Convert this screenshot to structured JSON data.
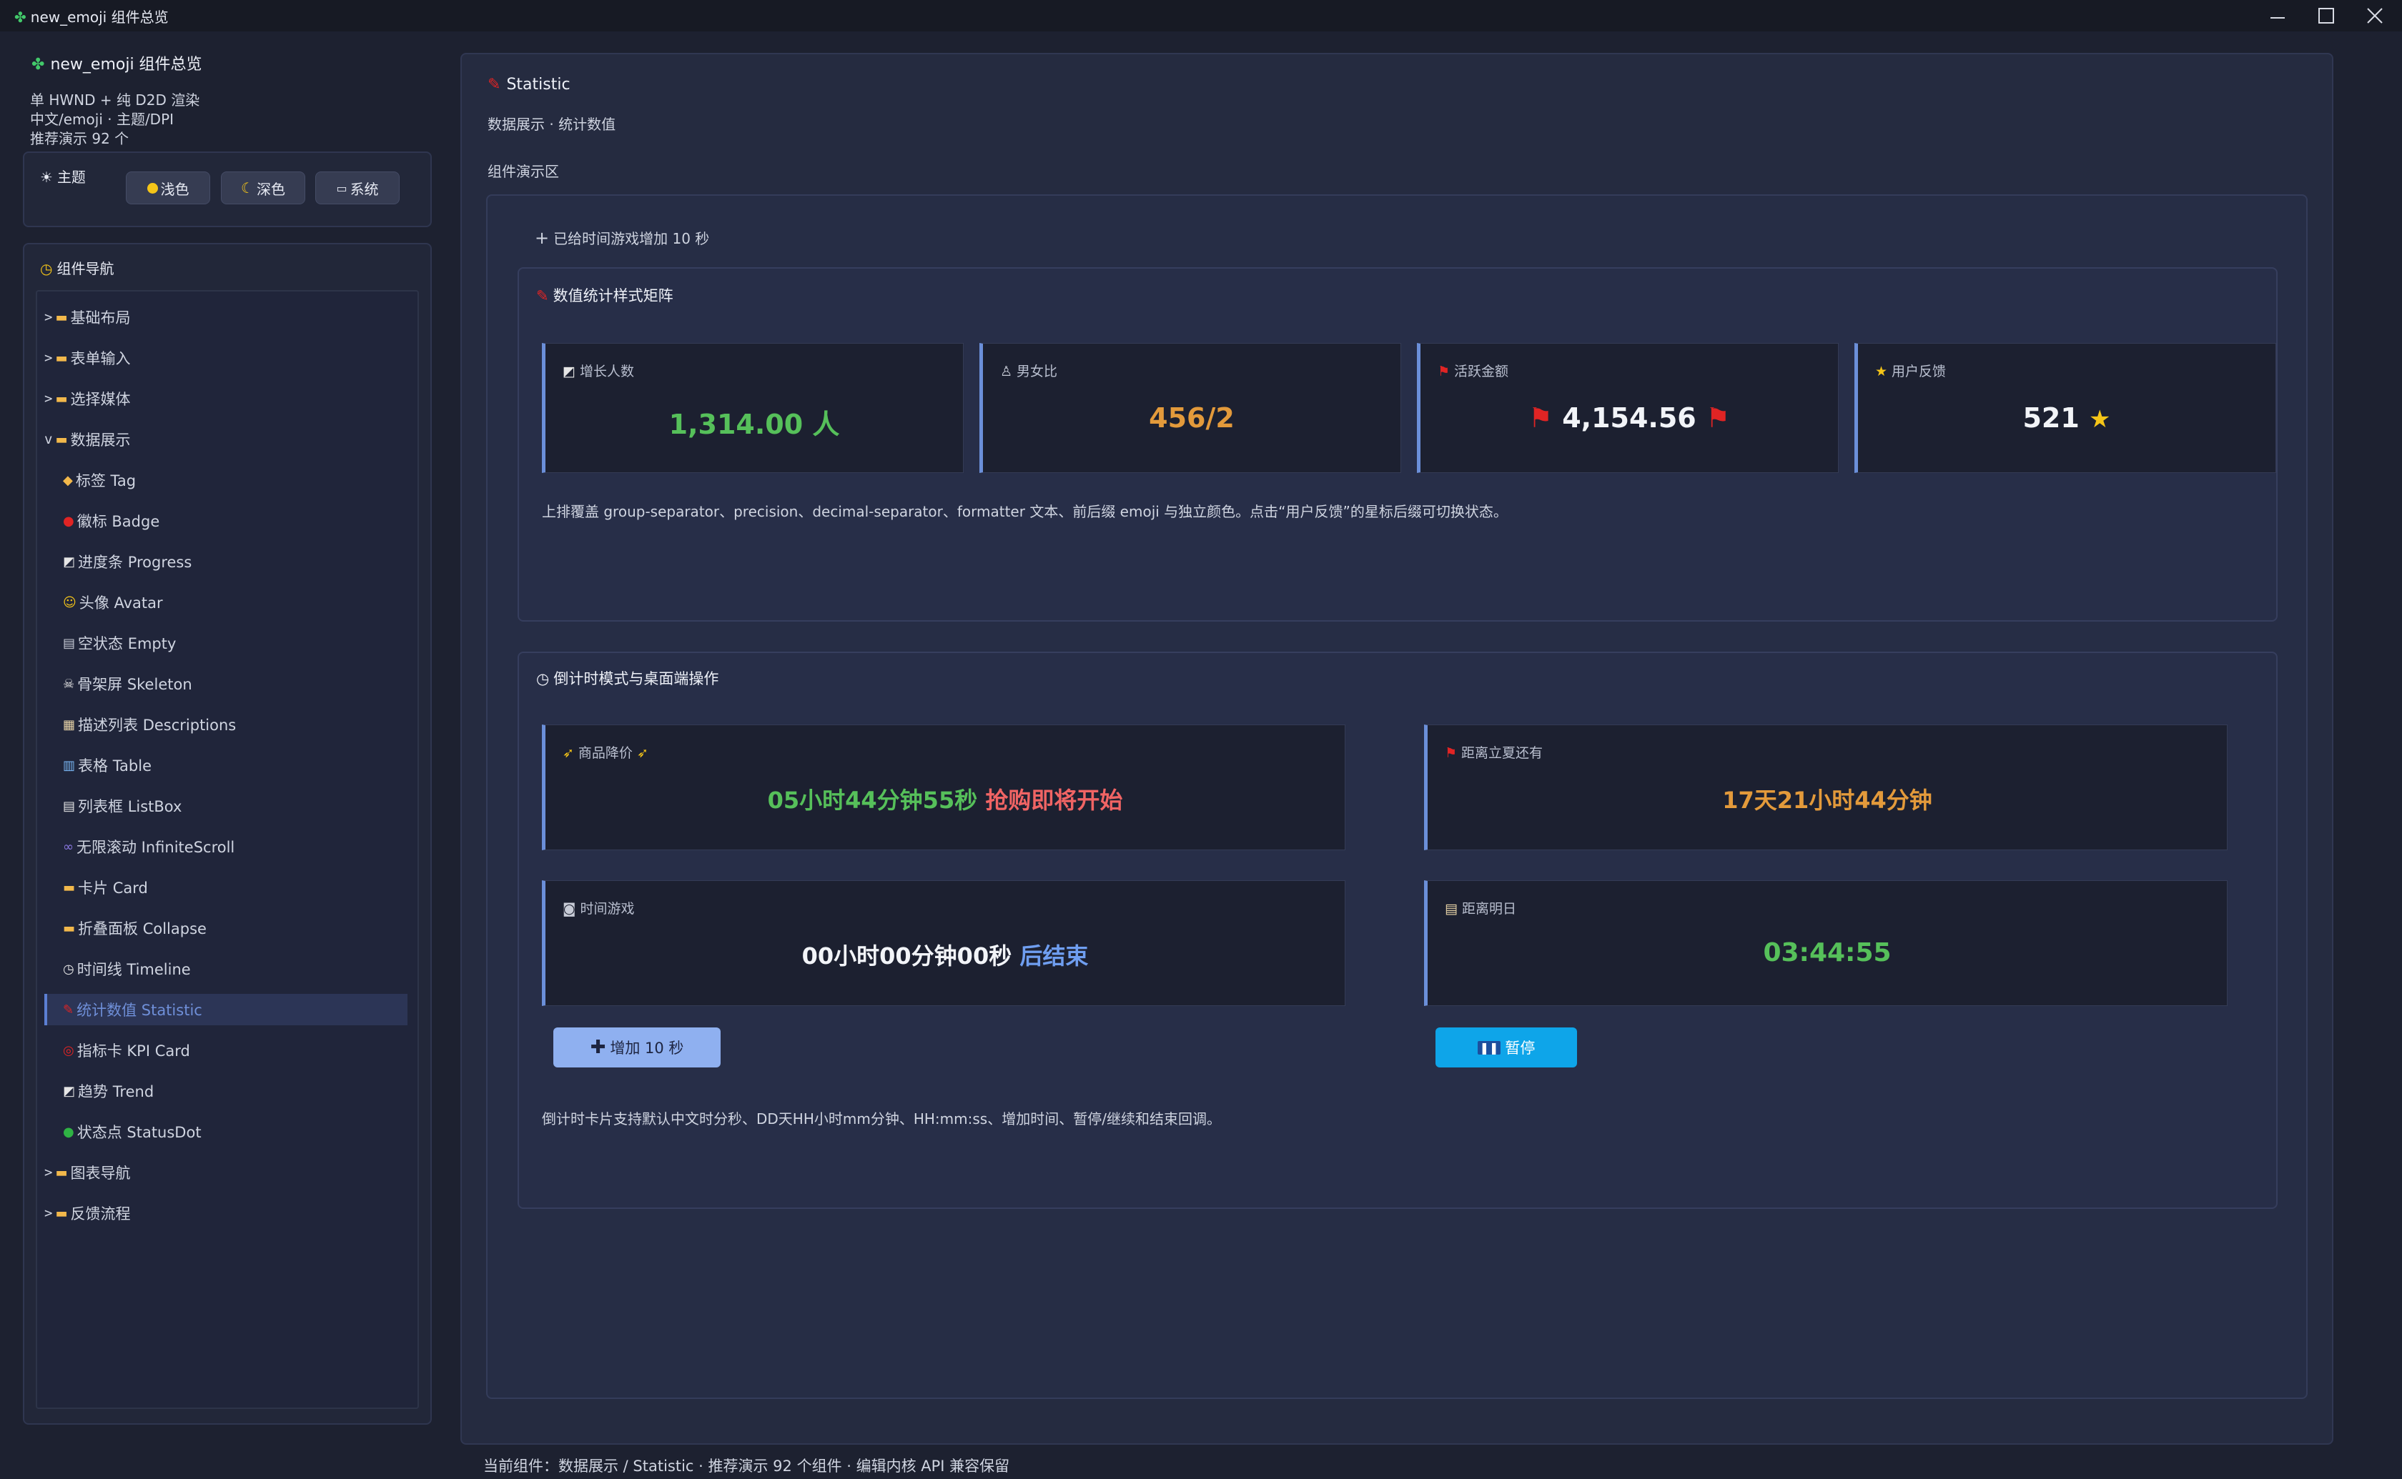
{
  "window": {
    "title": "new_emoji 组件总览",
    "app_icon": "puzzle-icon"
  },
  "sidebar": {
    "title": "new_emoji 组件总览",
    "info": [
      "单 HWND + 纯 D2D 渲染",
      "中文/emoji · 主题/DPI",
      "推荐演示 92 个"
    ],
    "theme": {
      "title": "主题",
      "buttons": [
        {
          "icon": "sun-icon",
          "label": "浅色"
        },
        {
          "icon": "moon-icon",
          "label": "深色"
        },
        {
          "icon": "laptop-icon",
          "label": "系统"
        }
      ]
    },
    "nav_title": "组件导航",
    "nav": [
      {
        "prefix": ">",
        "label": "基础布局"
      },
      {
        "prefix": ">",
        "label": "表单输入"
      },
      {
        "prefix": ">",
        "label": "选择媒体"
      },
      {
        "prefix": "v",
        "label": "数据展示"
      },
      {
        "label": "标签 Tag"
      },
      {
        "label": "徽标 Badge"
      },
      {
        "label": "进度条 Progress"
      },
      {
        "label": "头像 Avatar"
      },
      {
        "label": "空状态 Empty"
      },
      {
        "label": "骨架屏 Skeleton"
      },
      {
        "label": "描述列表 Descriptions"
      },
      {
        "label": "表格 Table"
      },
      {
        "label": "列表框 ListBox"
      },
      {
        "label": "无限滚动 InfiniteScroll"
      },
      {
        "label": "卡片 Card"
      },
      {
        "label": "折叠面板 Collapse"
      },
      {
        "label": "时间线 Timeline"
      },
      {
        "label": "统计数值 Statistic"
      },
      {
        "label": "指标卡 KPI Card"
      },
      {
        "label": "趋势 Trend"
      },
      {
        "label": "状态点 StatusDot"
      },
      {
        "prefix": ">",
        "label": "图表导航"
      },
      {
        "prefix": ">",
        "label": "反馈流程"
      }
    ]
  },
  "main": {
    "title": "Statistic",
    "subtitle": "数据展示 · 统计数值",
    "demo_title": "组件演示区",
    "notice": "已给时间游戏增加 10 秒",
    "matrix": {
      "title": "数值统计样式矩阵",
      "cards": [
        {
          "icon": "chart-up-icon",
          "label": "增长人数",
          "value": "1,314.00 人",
          "color": "#56c05a"
        },
        {
          "icon": "person-icon",
          "label": "男女比",
          "value": "456/2",
          "color": "#e39a3b"
        },
        {
          "icon": "flag-icon",
          "label": "活跃金额",
          "value": "4,154.56",
          "color": "#f2f4f8"
        },
        {
          "icon": "star-icon",
          "label": "用户反馈",
          "value": "521",
          "color": "#f2f4f8"
        }
      ],
      "desc": "上排覆盖 group-separator、precision、decimal-separator、formatter 文本、前后缀 emoji 与独立颜色。点击“用户反馈”的星标后缀可切换状态。"
    },
    "countdown": {
      "title": "倒计时模式与桌面端操作",
      "cards": [
        {
          "label": "商品降价",
          "value": "05小时44分钟55秒",
          "suffix": "抢购即将开始",
          "color": "#56c05a",
          "suffix_color": "#f06464"
        },
        {
          "label": "距离立夏还有",
          "value": "17天21小时44分钟",
          "color": "#e39a3b"
        },
        {
          "label": "时间游戏",
          "value": "00小时00分钟00秒",
          "suffix": "后结束",
          "color": "#f2f4f8",
          "suffix_color": "#6f9ef0"
        },
        {
          "label": "距离明日",
          "value": "03:44:55",
          "color": "#56c05a"
        }
      ],
      "add_button": "增加 10 秒",
      "pause_button": "暂停",
      "desc": "倒计时卡片支持默认中文时分秒、DD天HH小时mm分钟、HH:mm:ss、增加时间、暂停/继续和结束回调。"
    }
  },
  "status": "当前组件：数据展示 / Statistic · 推荐演示 92 个组件 · 编辑内核 API 兼容保留",
  "colors": {
    "accent": "#6b8fd9",
    "green": "#56c05a",
    "orange": "#e39a3b",
    "red": "#f06464",
    "blue": "#0ea5e9"
  }
}
